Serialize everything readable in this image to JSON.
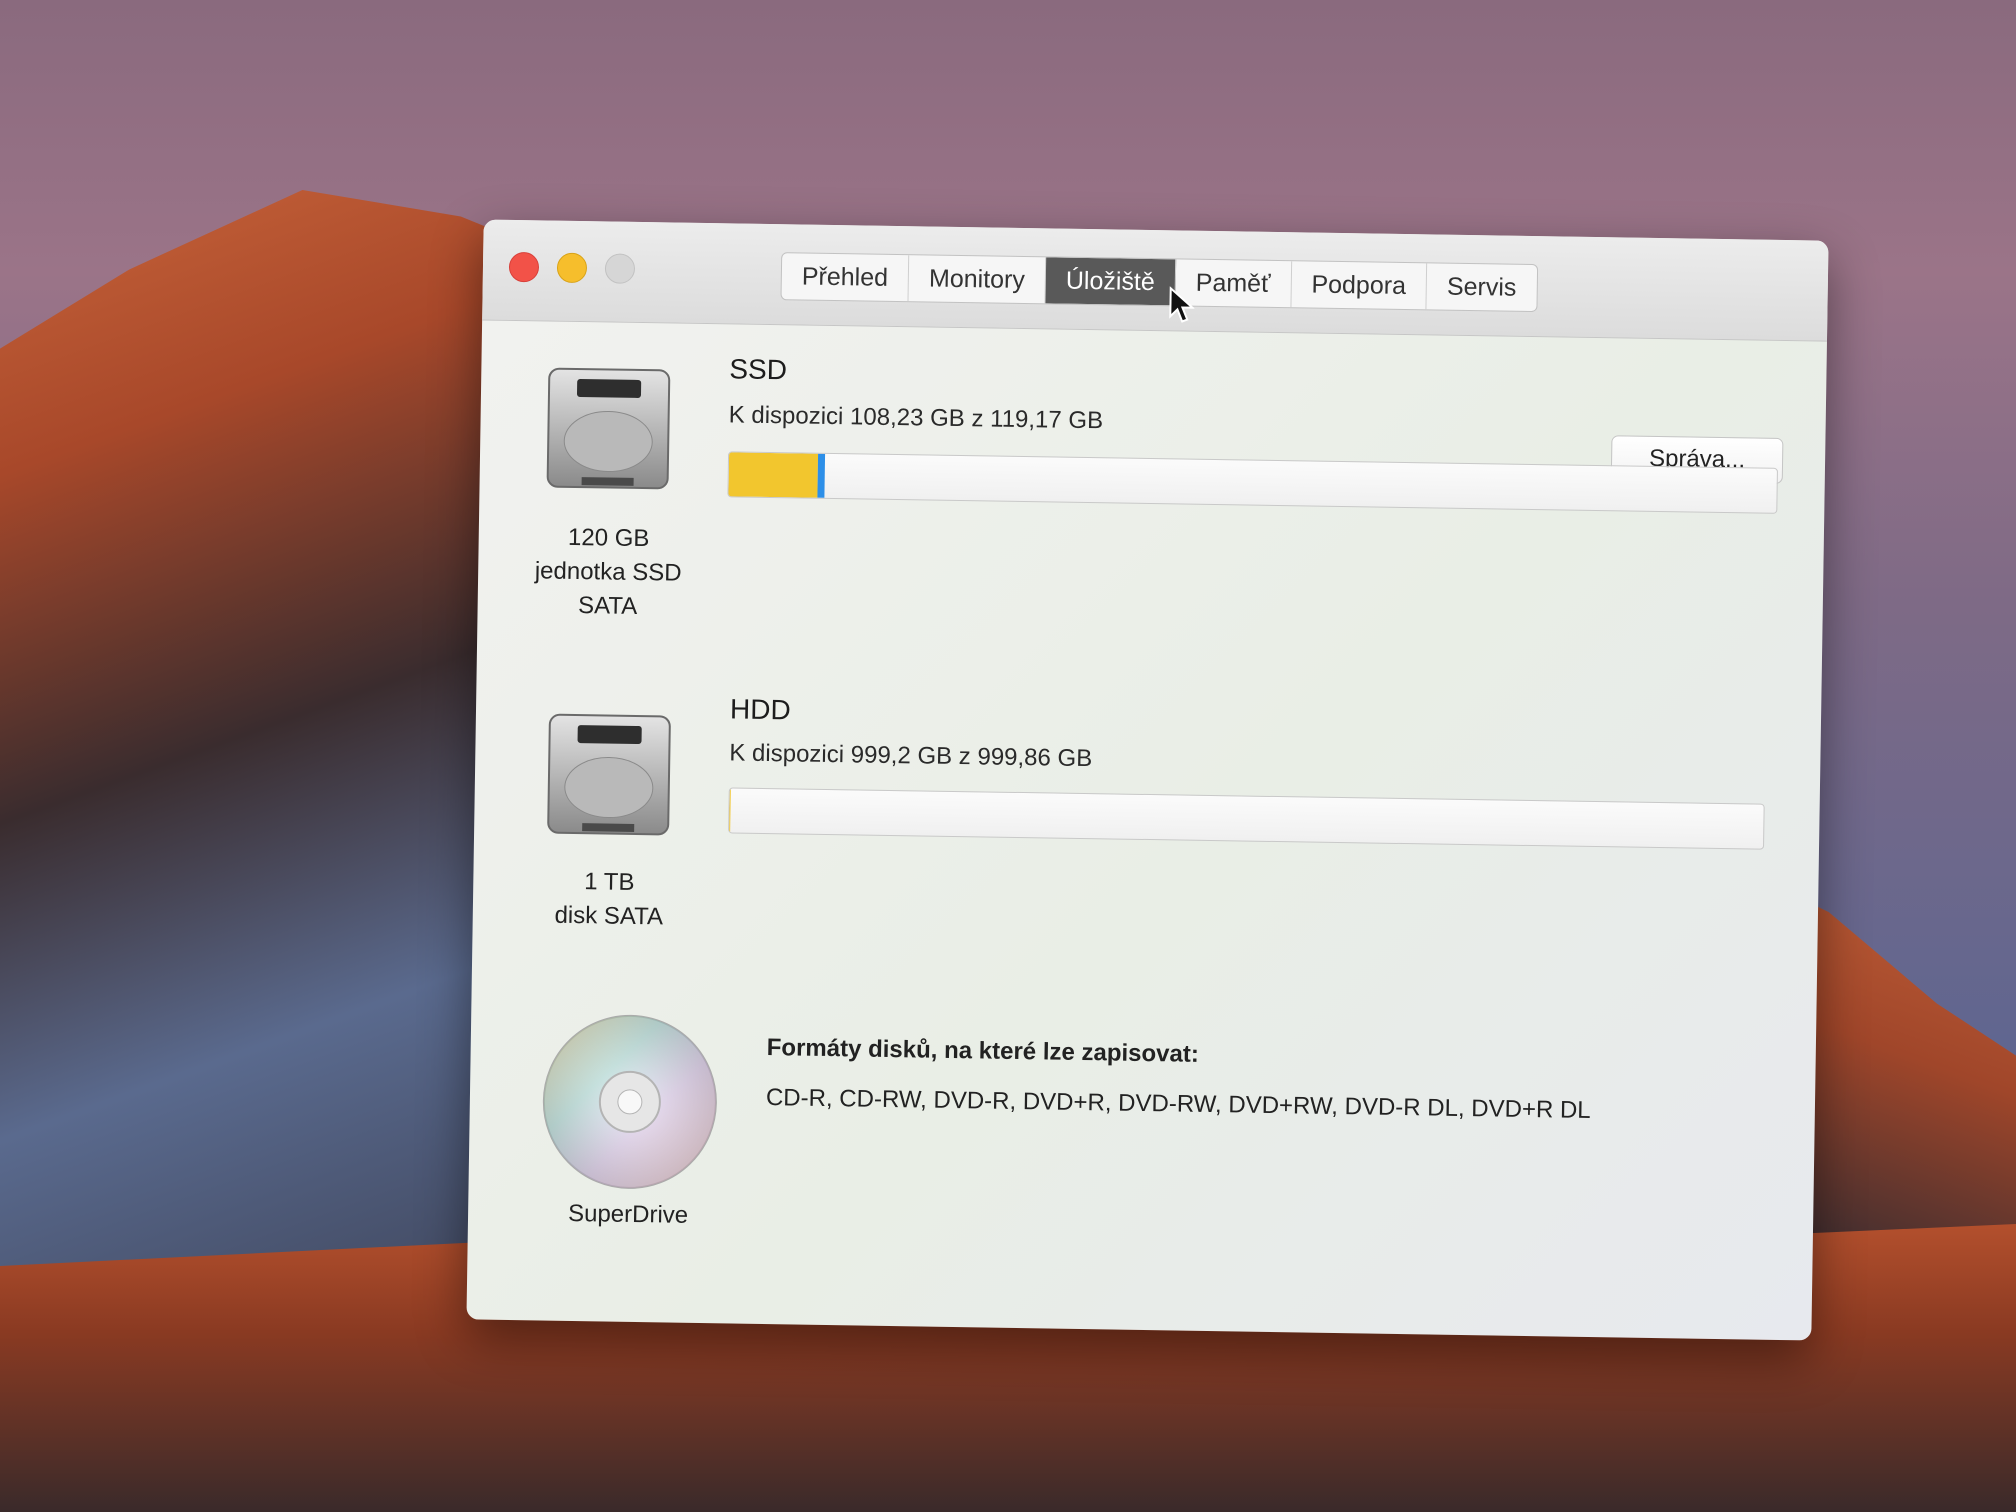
{
  "window": {
    "tabs": [
      "Přehled",
      "Monitory",
      "Úložiště",
      "Paměť",
      "Podpora",
      "Servis"
    ],
    "active_tab": "Úložiště"
  },
  "drives": {
    "ssd": {
      "name": "SSD",
      "available": "K dispozici 108,23 GB z 119,17 GB",
      "label_lines": [
        "120 GB",
        "jednotka SSD",
        "SATA"
      ],
      "manage_label": "Správa...",
      "usage": {
        "used_fraction_yellow": 0.085,
        "used_fraction_blue": 0.007
      }
    },
    "hdd": {
      "name": "HDD",
      "available": "K dispozici 999,2 GB z 999,86 GB",
      "label_lines": [
        "1 TB",
        "disk SATA"
      ],
      "usage": {
        "used_fraction": 0.0007
      }
    },
    "superdrive": {
      "label": "SuperDrive",
      "formats_title": "Formáty disků, na které lze zapisovat:",
      "formats": "CD-R, CD-RW, DVD-R, DVD+R, DVD-RW, DVD+RW, DVD-R DL, DVD+R DL"
    }
  },
  "colors": {
    "accent_yellow": "#f2c62e",
    "accent_blue": "#2d8fe8",
    "tab_active_bg": "#595959"
  }
}
